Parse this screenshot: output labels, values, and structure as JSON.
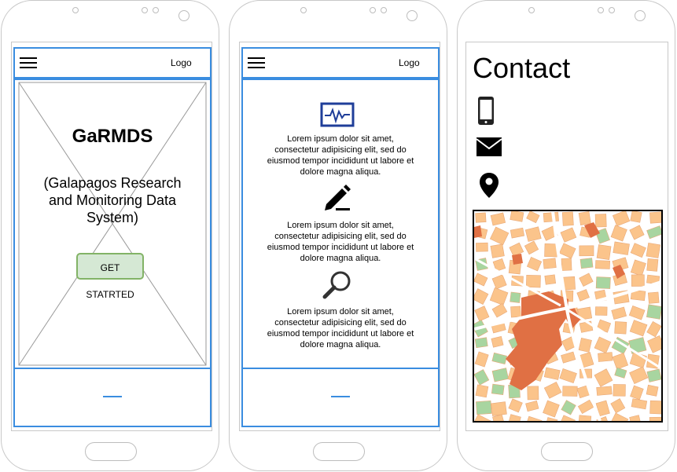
{
  "home": {
    "logo": "Logo",
    "title": "GaRMDS",
    "subtitle": "(Galapagos Research and Monitoring Data System)",
    "cta_label": "GET STATRTED"
  },
  "features": {
    "logo": "Logo",
    "items": [
      {
        "icon": "monitor-chart-icon",
        "text": "Lorem ipsum dolor sit amet, consectetur adipisicing elit, sed do eiusmod tempor incididunt ut labore et dolore magna aliqua."
      },
      {
        "icon": "pencil-icon",
        "text": "Lorem ipsum dolor sit amet, consectetur adipisicing elit, sed do eiusmod tempor incididunt ut labore et dolore magna aliqua."
      },
      {
        "icon": "magnifier-icon",
        "text": "Lorem ipsum dolor sit amet, consectetur adipisicing elit, sed do eiusmod tempor incididunt ut labore et dolore magna aliqua."
      }
    ]
  },
  "contact": {
    "title": "Contact",
    "icons": [
      "phone-icon",
      "envelope-icon",
      "location-pin-icon"
    ],
    "map_colors": {
      "block": "#fbc48b",
      "park": "#a8d5a0",
      "landmark": "#e07044",
      "road": "#ffffff"
    }
  }
}
